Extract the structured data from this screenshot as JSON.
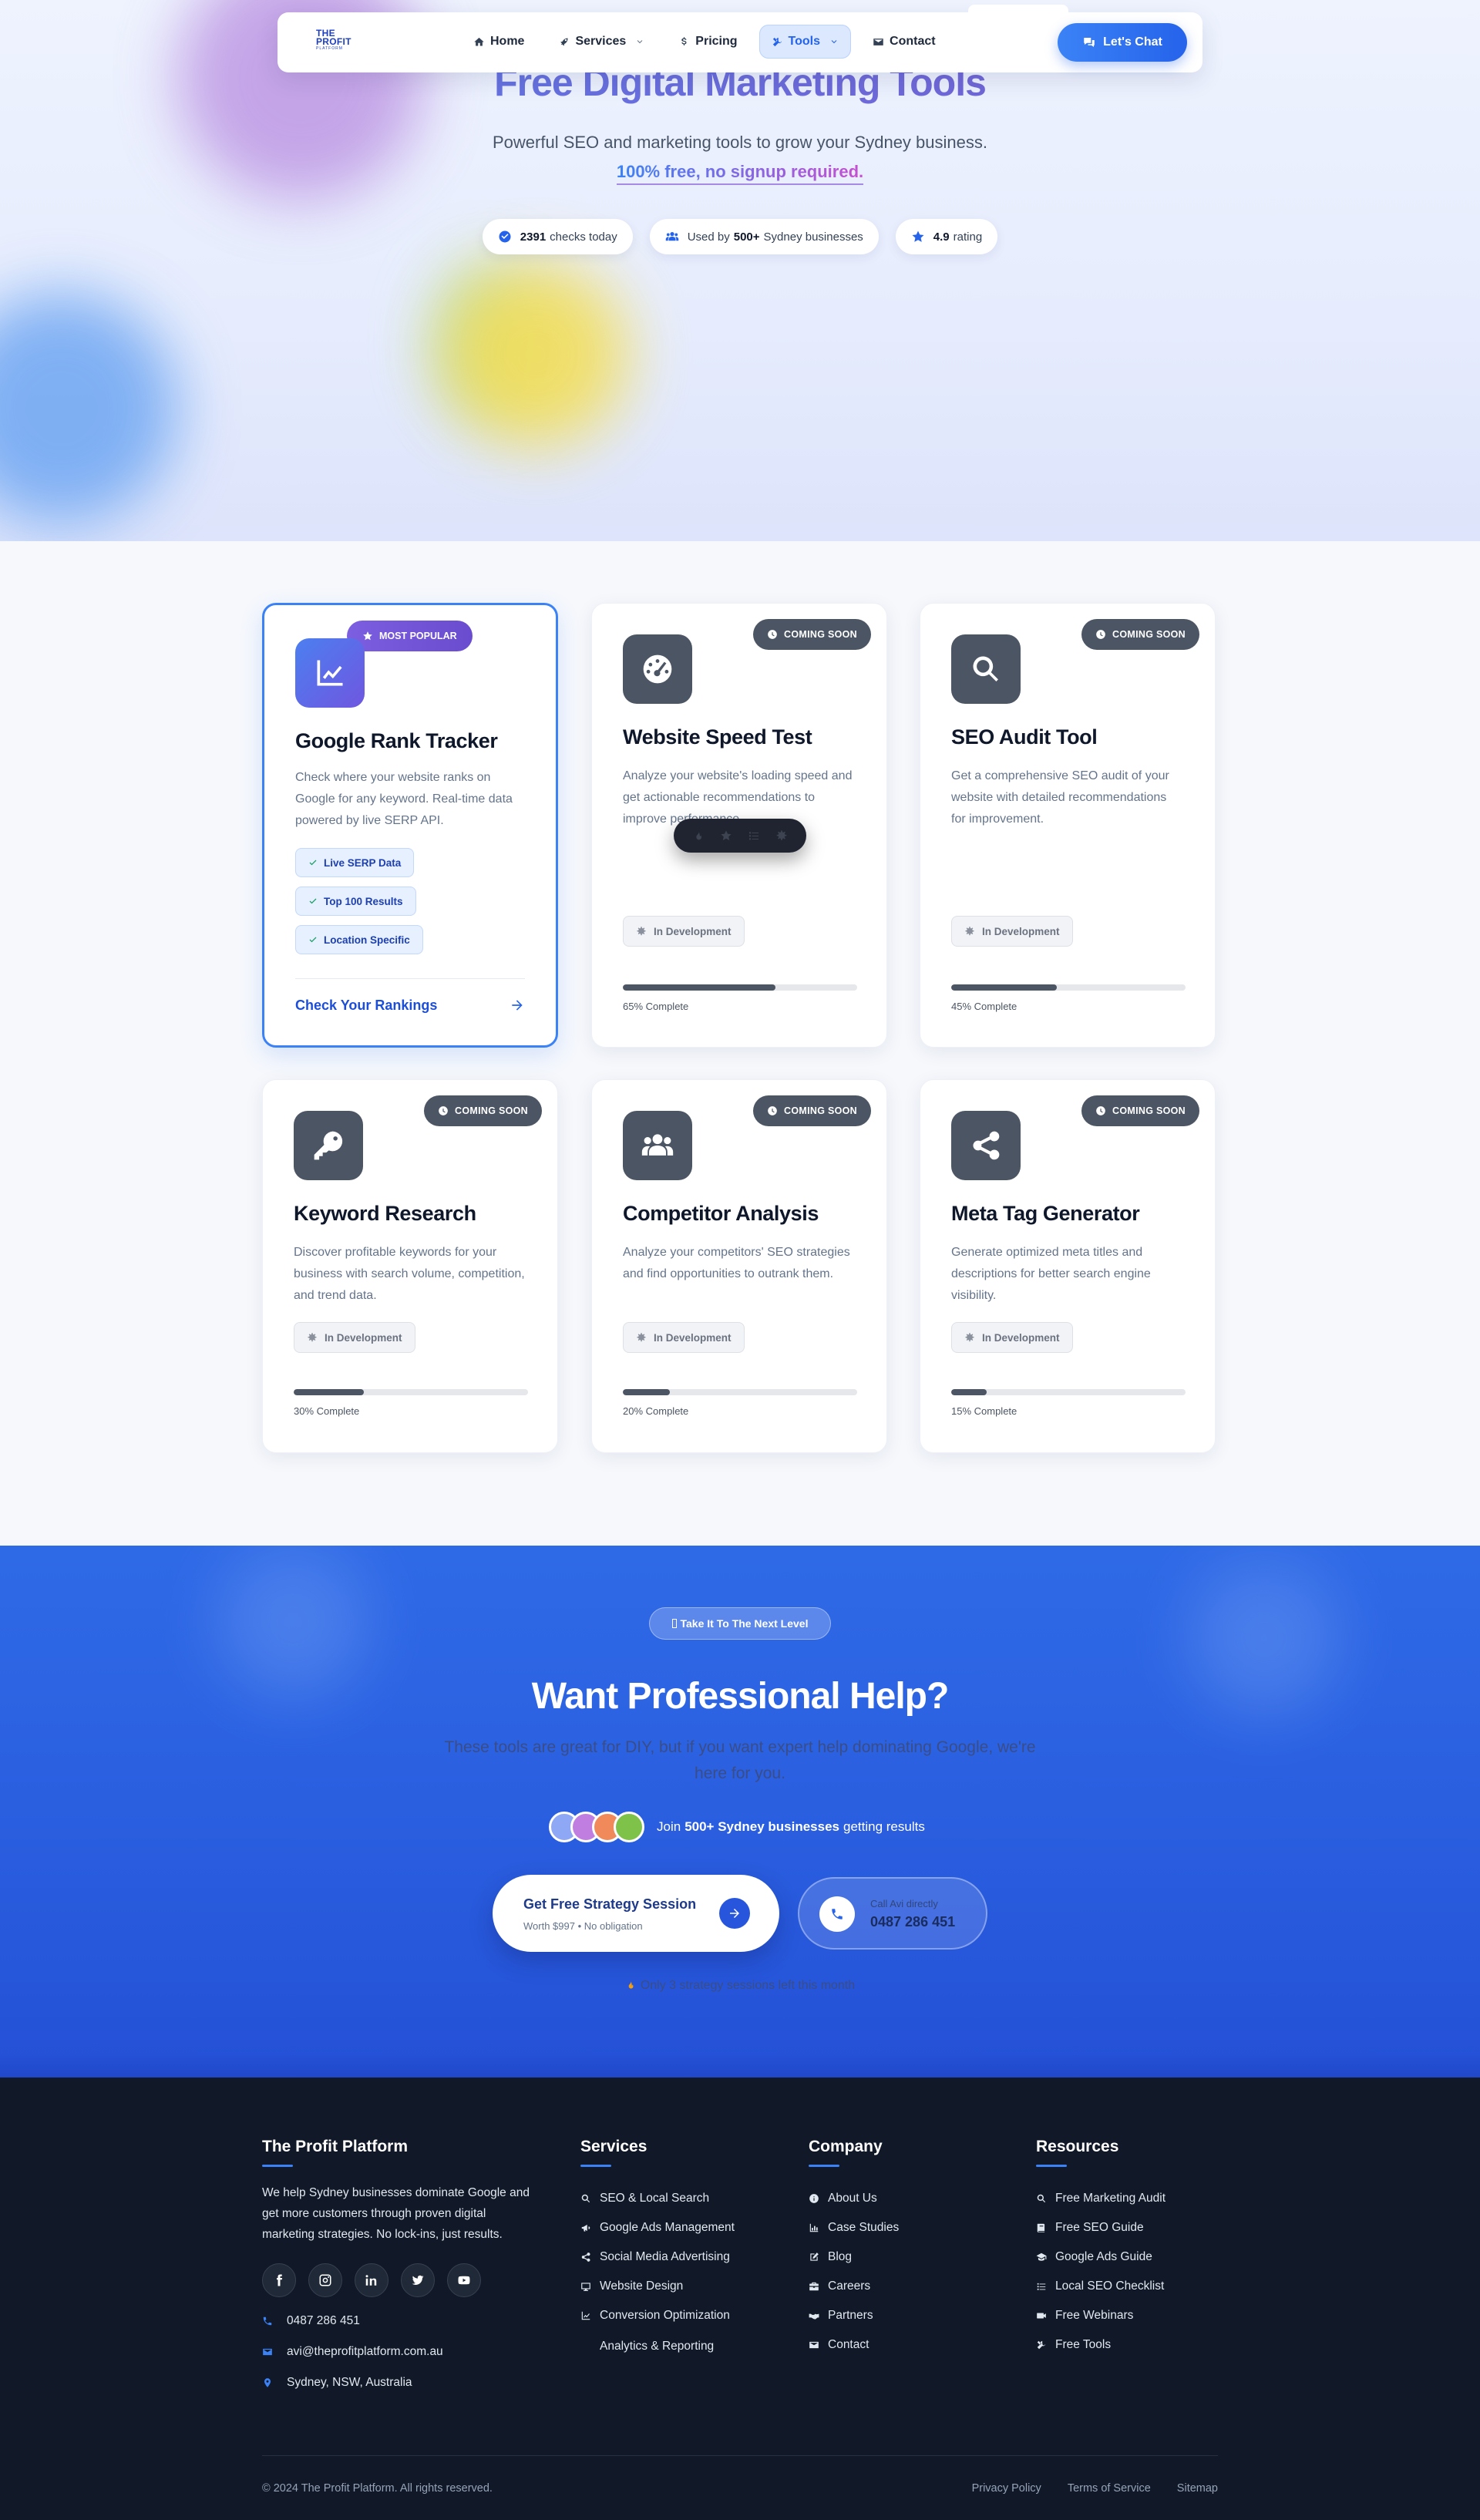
{
  "nav": {
    "logo": {
      "line1": "THE",
      "line2": "PROFIT",
      "line3": "PLATFORM"
    },
    "items": [
      {
        "label": "Home",
        "icon": "home-icon"
      },
      {
        "label": "Services",
        "icon": "rocket-icon",
        "dropdown": true
      },
      {
        "label": "Pricing",
        "icon": "dollar-icon"
      },
      {
        "label": "Tools",
        "icon": "tools-icon",
        "dropdown": true,
        "active": true
      },
      {
        "label": "Contact",
        "icon": "envelope-icon"
      }
    ],
    "chat_label": "Let's Chat"
  },
  "hero": {
    "title": "Free Digital Marketing Tools",
    "subtitle": "Powerful SEO and marketing tools to grow your Sydney business.",
    "highlight": "100% free, no signup required.",
    "stats": [
      {
        "value": "2391",
        "label": "checks today",
        "icon": "check-circle-icon"
      },
      {
        "pre": "Used by",
        "value": "500+",
        "label": "Sydney businesses",
        "icon": "users-icon"
      },
      {
        "value": "4.9",
        "label": "rating",
        "icon": "star-icon"
      }
    ]
  },
  "tools": [
    {
      "title": "Google Rank Tracker",
      "description": "Check where your website ranks on Google for any keyword. Real-time data powered by live SERP API.",
      "badge": "MOST POPULAR",
      "icon": "chart-line-icon",
      "features": [
        "Live SERP Data",
        "Top 100 Results",
        "Location Specific"
      ],
      "cta": "Check Your Rankings"
    },
    {
      "title": "Website Speed Test",
      "description": "Analyze your website's loading speed and get actionable recommendations to improve performance.",
      "badge": "COMING SOON",
      "icon": "speedometer-icon",
      "status": "In Development",
      "progress": 65,
      "progress_label": "65% Complete"
    },
    {
      "title": "SEO Audit Tool",
      "description": "Get a comprehensive SEO audit of your website with detailed recommendations for improvement.",
      "badge": "COMING SOON",
      "icon": "search-icon",
      "status": "In Development",
      "progress": 45,
      "progress_label": "45% Complete"
    },
    {
      "title": "Keyword Research",
      "description": "Discover profitable keywords for your business with search volume, competition, and trend data.",
      "badge": "COMING SOON",
      "icon": "key-icon",
      "status": "In Development",
      "progress": 30,
      "progress_label": "30% Complete"
    },
    {
      "title": "Competitor Analysis",
      "description": "Analyze your competitors' SEO strategies and find opportunities to outrank them.",
      "badge": "COMING SOON",
      "icon": "users-icon",
      "status": "In Development",
      "progress": 20,
      "progress_label": "20% Complete"
    },
    {
      "title": "Meta Tag Generator",
      "description": "Generate optimized meta titles and descriptions for better search engine visibility.",
      "badge": "COMING SOON",
      "icon": "share-icon",
      "status": "In Development",
      "progress": 15,
      "progress_label": "15% Complete"
    }
  ],
  "cta": {
    "pill": "Take It To The Next Level",
    "title": "Want Professional Help?",
    "lead": "These tools are great for DIY, but if you want expert help dominating Google, we're here for you.",
    "proof_pre": "Join",
    "proof_bold": "500+ Sydney businesses",
    "proof_post": "getting results",
    "avatar_colors": [
      "#8fa8f5",
      "#c07fe0",
      "#f08a5a",
      "#7fc24a"
    ],
    "primary_title": "Get Free Strategy Session",
    "primary_sub": "Worth $997 • No obligation",
    "call_label": "Call Avi directly",
    "call_number": "0487 286 451",
    "note": "Only 3 strategy sessions left this month"
  },
  "footer": {
    "brand": "The Profit Platform",
    "about": "We help Sydney businesses dominate Google and get more customers through proven digital marketing strategies. No lock-ins, just results.",
    "socials": [
      "facebook-icon",
      "instagram-icon",
      "linkedin-icon",
      "twitter-icon",
      "youtube-icon"
    ],
    "contact": {
      "phone": "0487 286 451",
      "email": "avi@theprofitplatform.com.au",
      "location": "Sydney, NSW, Australia"
    },
    "services": {
      "title": "Services",
      "items": [
        "SEO & Local Search",
        "Google Ads Management",
        "Social Media Advertising",
        "Website Design",
        "Conversion Optimization",
        "Analytics & Reporting"
      ]
    },
    "company": {
      "title": "Company",
      "items": [
        "About Us",
        "Case Studies",
        "Blog",
        "Careers",
        "Partners",
        "Contact"
      ]
    },
    "resources": {
      "title": "Resources",
      "items": [
        "Free Marketing Audit",
        "Free SEO Guide",
        "Google Ads Guide",
        "Local SEO Checklist",
        "Free Webinars",
        "Free Tools"
      ]
    },
    "copyright": "© 2024 The Profit Platform. All rights reserved.",
    "legal": [
      "Privacy Policy",
      "Terms of Service",
      "Sitemap"
    ]
  },
  "colors": {
    "primary": "#2563eb",
    "accent_purple": "#7c5fe0",
    "footer_bg": "#111827",
    "badge_gray": "#4b5563"
  }
}
